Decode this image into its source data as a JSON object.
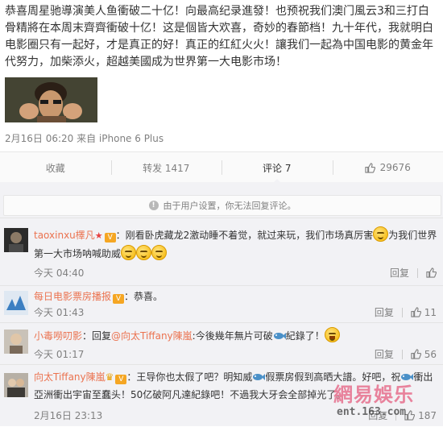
{
  "post": {
    "text": "恭喜周星驰導演美人鱼衝破二十亿！向最高纪录進發！也预祝我们澳门風云3和三打白骨精將在本周末齊齊衝破十亿！这是個皆大欢喜，奇妙的春節档！九十年代，我就明白电影圈只有一起好，才是真正的好！真正的红紅火火！讓我们一起為中国电影的黄金年代努力，加柴添火，超越美國成为世界第一大电影市场！",
    "meta": "2月16日 06:20 来自 iPhone 6 Plus"
  },
  "actions": {
    "favorite": "收藏",
    "repost": "转发 1417",
    "comment": "评论 7",
    "likes": "29676"
  },
  "notice": "由于用户设置，你无法回复评论。",
  "comments": [
    {
      "user": "taoxinxu檡凡",
      "text_a": "：刚看卧虎藏龙2激动睡不着觉，就过来玩，我们市场真厉害",
      "text_b": "为我们世界第一大市场呐喊助威",
      "time": "今天 04:40",
      "reply": "回复",
      "likes": ""
    },
    {
      "user": "每日电影票房播报",
      "text_a": "：恭喜。",
      "time": "今天 01:43",
      "reply": "回复",
      "likes": "11"
    },
    {
      "user": "小毒嘮叨影",
      "text_a": "：回复",
      "mention": "@向太Tiffany陳嵐",
      "text_b": ":今後幾年無片可破",
      "text_c": "紀錄了！",
      "time": "今天 01:17",
      "reply": "回复",
      "likes": "56"
    },
    {
      "user": "向太Tiffany陳嵐",
      "text_a": "：王导你也太假了吧？明知威",
      "text_b": "假票房假到高晒大譜。好吧，祝",
      "text_c": "衝出亞洲衝出宇宙至蠢头！50亿破阿凡達紀錄吧！不過我大牙会全部掉光了。",
      "time": "2月16日 23:13",
      "reply": "回复",
      "likes": "187"
    }
  ],
  "watermark": {
    "brand": "網易娛乐",
    "domain": "ent.163.com"
  },
  "colors": {
    "username": "#eb7350",
    "panel_bg": "#f2f2f5",
    "meta": "#808080"
  }
}
